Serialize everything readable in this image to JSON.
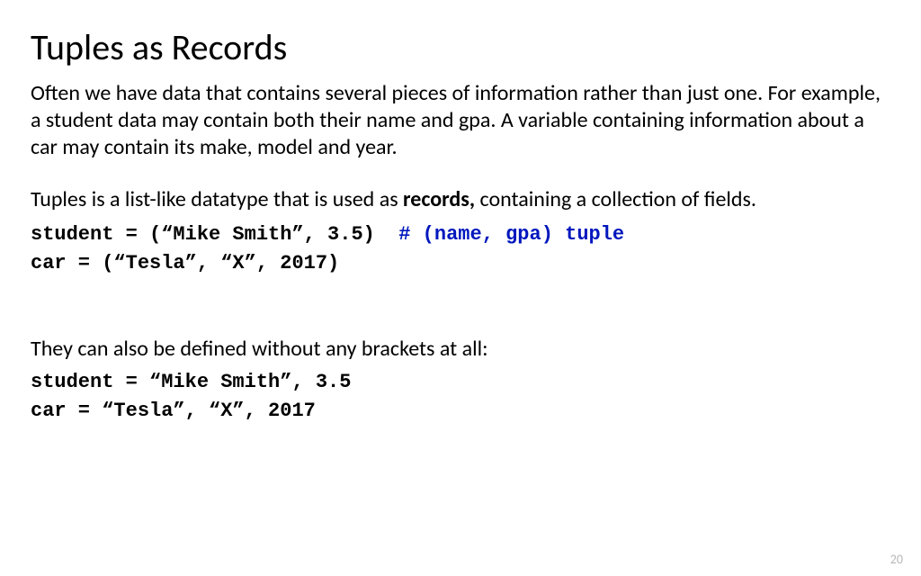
{
  "slide": {
    "title": "Tuples as Records",
    "para1": "Often we have data that contains several pieces of information rather than just one. For example, a student data may contain both their name and gpa.  A variable containing information about a car may contain its make, model and year.",
    "para2_pre": "Tuples is a list-like datatype that is used as ",
    "para2_bold": "records,",
    "para2_post": " containing a collection of fields.",
    "code1_line1_code": "student = (“Mike Smith”, 3.5)  ",
    "code1_line1_comment": "# (name, gpa) tuple",
    "code1_line2": "car = (“Tesla”, “X”, 2017)",
    "para3": "They can also be defined without any brackets at all:",
    "code2_line1": "student = “Mike Smith”, 3.5",
    "code2_line2": "car = “Tesla”, “X”, 2017",
    "page_number": "20"
  }
}
